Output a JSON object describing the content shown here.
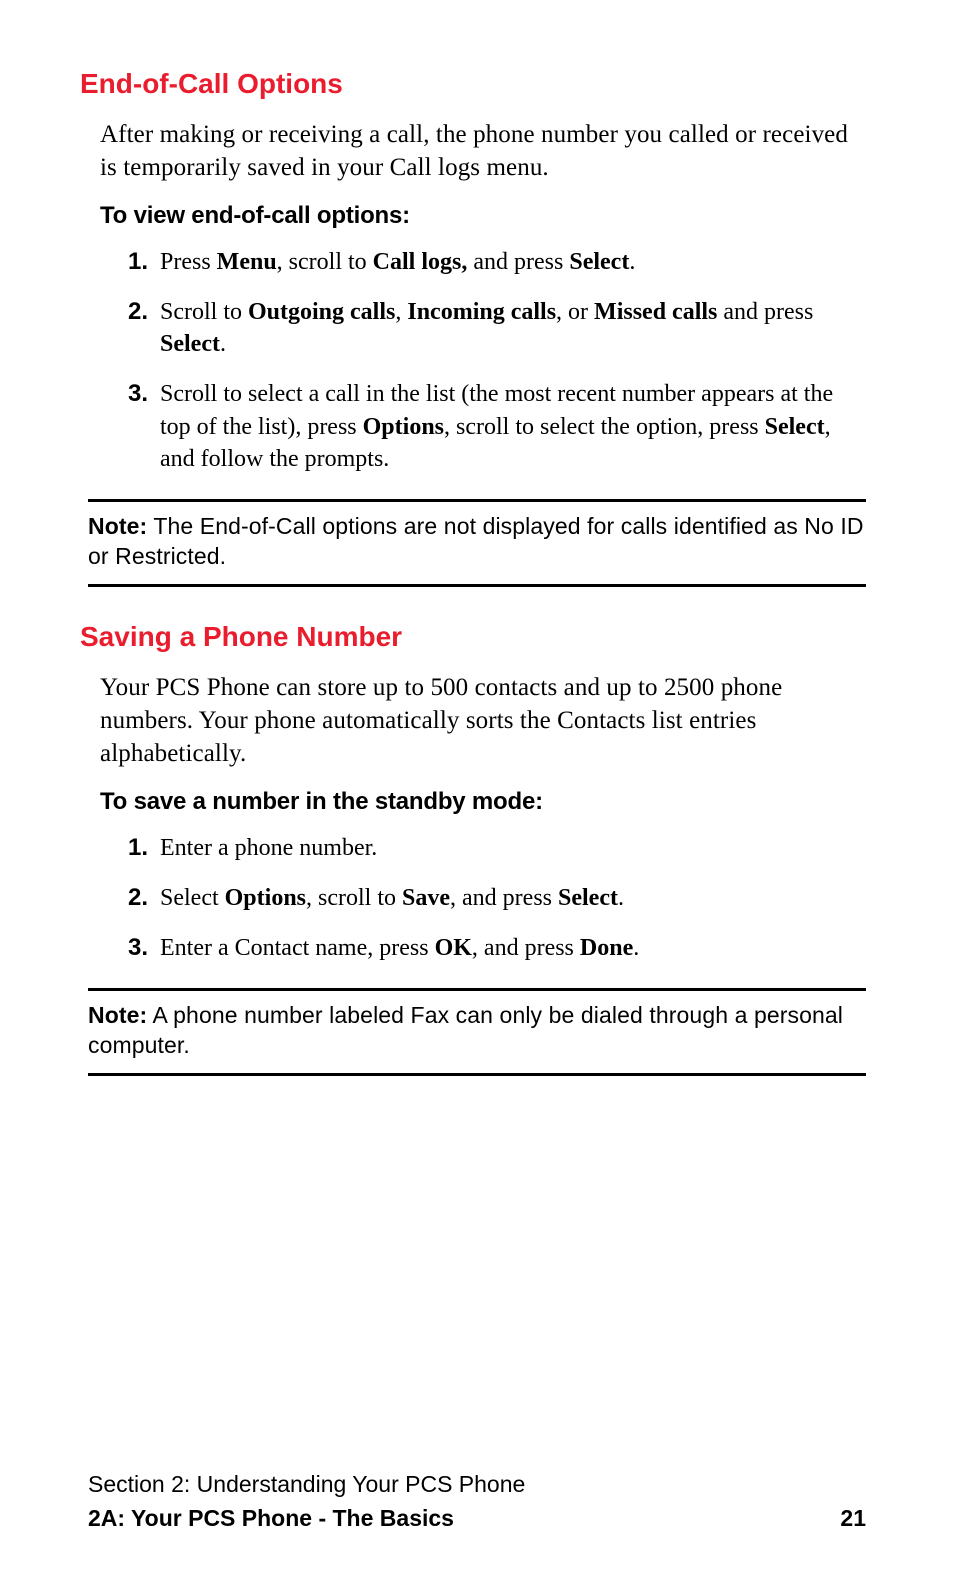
{
  "s1": {
    "heading": "End-of-Call Options",
    "intro": "After making or receiving a call, the phone number you called or received is temporarily saved in your Call logs menu.",
    "subhead": "To view end-of-call options:",
    "step1_num": "1.",
    "step1_a": "Press ",
    "step1_b": "Menu",
    "step1_c": ", scroll to ",
    "step1_d": "Call logs,",
    "step1_e": " and press ",
    "step1_f": "Select",
    "step1_g": ".",
    "step2_num": "2.",
    "step2_a": "Scroll to ",
    "step2_b": "Outgoing calls",
    "step2_c": ", ",
    "step2_d": "Incoming calls",
    "step2_e": ", or ",
    "step2_f": "Missed calls",
    "step2_g": " and press ",
    "step2_h": "Select",
    "step2_i": ".",
    "step3_num": "3.",
    "step3_a": "Scroll to select a call in the list (the most recent number appears at the top of the list), press ",
    "step3_b": "Options",
    "step3_c": ", scroll to select the option, press ",
    "step3_d": "Select",
    "step3_e": ", and follow the prompts.",
    "note_label": "Note:",
    "note_text": " The End-of-Call options are not displayed for calls identified as No ID or Restricted."
  },
  "s2": {
    "heading": "Saving a Phone Number",
    "intro": "Your PCS Phone can store up to 500 contacts and up to 2500 phone numbers. Your phone automatically sorts the Contacts list entries alphabetically.",
    "subhead": "To save a number in the standby mode:",
    "step1_num": "1.",
    "step1_a": "Enter a phone number.",
    "step2_num": "2.",
    "step2_a": "Select ",
    "step2_b": "Options",
    "step2_c": ", scroll to ",
    "step2_d": "Save",
    "step2_e": ", and press ",
    "step2_f": "Select",
    "step2_g": ".",
    "step3_num": "3.",
    "step3_a": "Enter a Contact name, press ",
    "step3_b": "OK",
    "step3_c": ", and press ",
    "step3_d": "Done",
    "step3_e": ".",
    "note_label": "Note:",
    "note_text": " A phone number labeled Fax can only be dialed through a personal computer."
  },
  "footer": {
    "line1": "Section 2: Understanding Your PCS Phone",
    "line2": "2A: Your PCS Phone - The Basics",
    "page": "21"
  }
}
